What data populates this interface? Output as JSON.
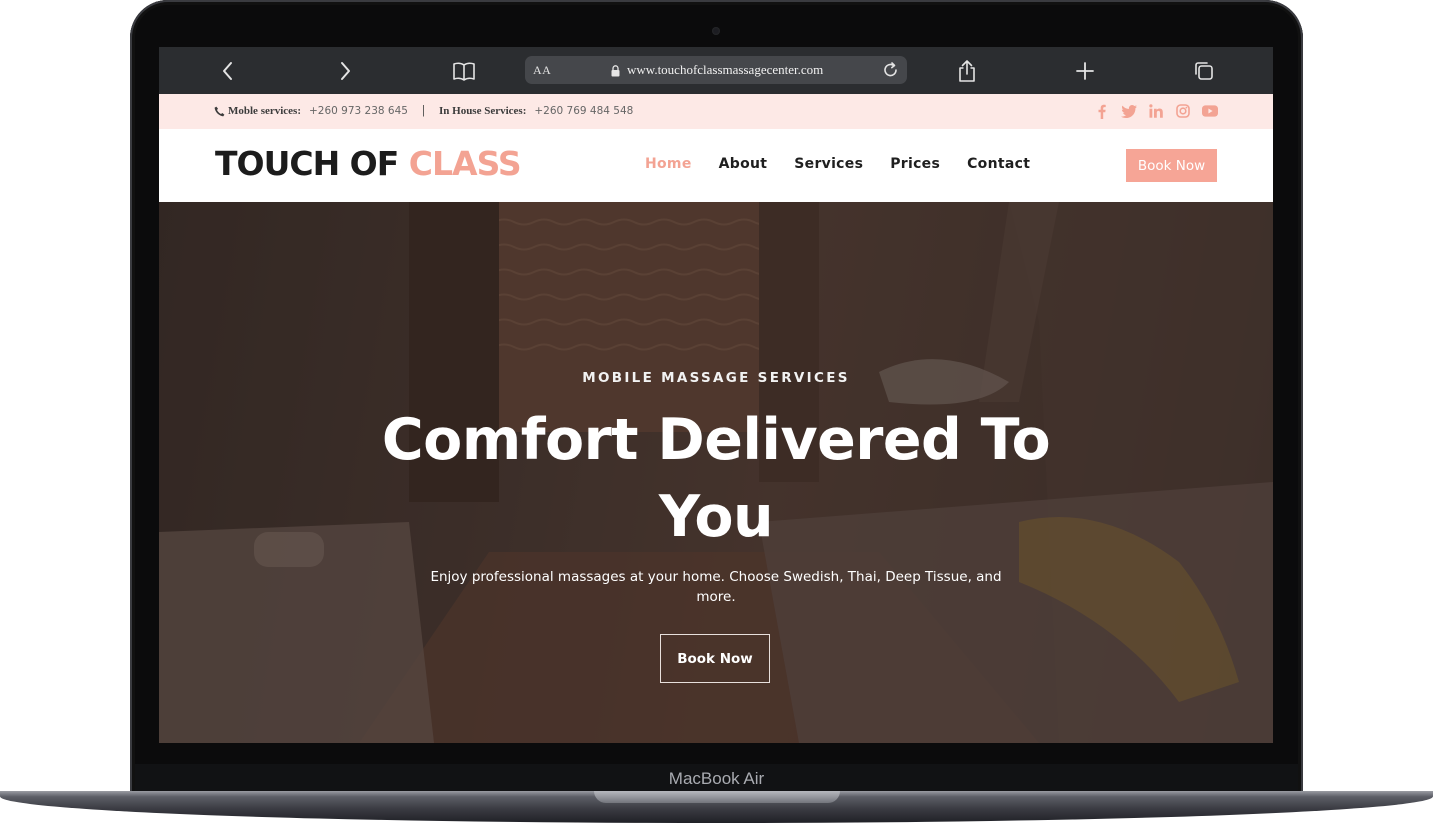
{
  "device": {
    "model_label": "MacBook Air"
  },
  "browser": {
    "text_size_label": "AA",
    "url": "www.touchofclassmassagecenter.com"
  },
  "topbar": {
    "mobile_label": "Moble services:",
    "mobile_number": "+260 973 238 645",
    "separator": "|",
    "inhouse_label": "In House Services:",
    "inhouse_number": "+260 769 484 548",
    "socials": [
      "facebook-icon",
      "twitter-icon",
      "linkedin-icon",
      "instagram-icon",
      "youtube-icon"
    ]
  },
  "header": {
    "logo_main": "TOUCH OF ",
    "logo_accent": "CLASS",
    "nav": [
      {
        "label": "Home",
        "active": true
      },
      {
        "label": "About"
      },
      {
        "label": "Services"
      },
      {
        "label": "Prices"
      },
      {
        "label": "Contact"
      }
    ],
    "cta": "Book Now"
  },
  "hero": {
    "eyebrow": "MOBILE MASSAGE SERVICES",
    "headline": "Comfort Delivered To You",
    "subtext": "Enjoy professional massages at your home. Choose Swedish, Thai, Deep Tissue, and more.",
    "button": "Book Now"
  },
  "colors": {
    "accent": "#f3a393",
    "topbar_bg": "#fde9e6",
    "browser_bar": "#2b2d30"
  }
}
